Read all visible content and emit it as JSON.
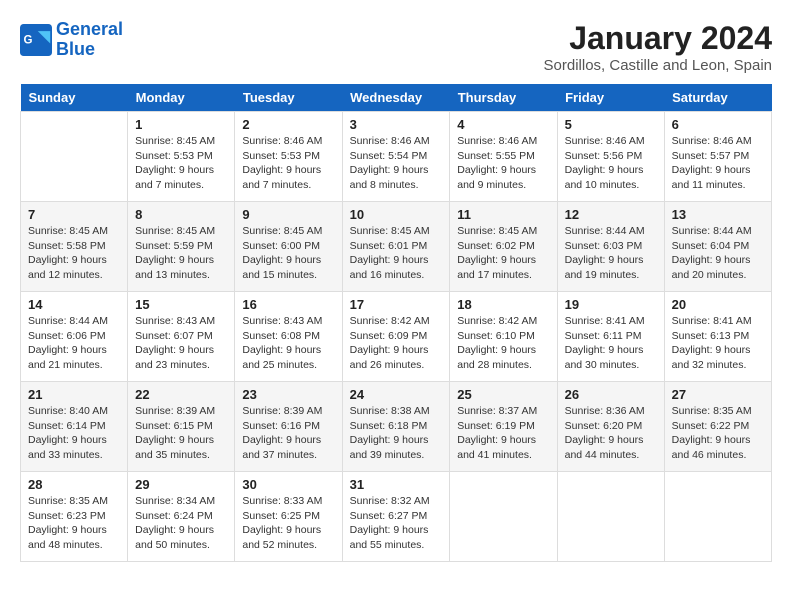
{
  "logo": {
    "line1": "General",
    "line2": "Blue"
  },
  "title": "January 2024",
  "location": "Sordillos, Castille and Leon, Spain",
  "headers": [
    "Sunday",
    "Monday",
    "Tuesday",
    "Wednesday",
    "Thursday",
    "Friday",
    "Saturday"
  ],
  "weeks": [
    [
      {
        "day": "",
        "sunrise": "",
        "sunset": "",
        "daylight": ""
      },
      {
        "day": "1",
        "sunrise": "Sunrise: 8:45 AM",
        "sunset": "Sunset: 5:53 PM",
        "daylight": "Daylight: 9 hours and 7 minutes."
      },
      {
        "day": "2",
        "sunrise": "Sunrise: 8:46 AM",
        "sunset": "Sunset: 5:53 PM",
        "daylight": "Daylight: 9 hours and 7 minutes."
      },
      {
        "day": "3",
        "sunrise": "Sunrise: 8:46 AM",
        "sunset": "Sunset: 5:54 PM",
        "daylight": "Daylight: 9 hours and 8 minutes."
      },
      {
        "day": "4",
        "sunrise": "Sunrise: 8:46 AM",
        "sunset": "Sunset: 5:55 PM",
        "daylight": "Daylight: 9 hours and 9 minutes."
      },
      {
        "day": "5",
        "sunrise": "Sunrise: 8:46 AM",
        "sunset": "Sunset: 5:56 PM",
        "daylight": "Daylight: 9 hours and 10 minutes."
      },
      {
        "day": "6",
        "sunrise": "Sunrise: 8:46 AM",
        "sunset": "Sunset: 5:57 PM",
        "daylight": "Daylight: 9 hours and 11 minutes."
      }
    ],
    [
      {
        "day": "7",
        "sunrise": "Sunrise: 8:45 AM",
        "sunset": "Sunset: 5:58 PM",
        "daylight": "Daylight: 9 hours and 12 minutes."
      },
      {
        "day": "8",
        "sunrise": "Sunrise: 8:45 AM",
        "sunset": "Sunset: 5:59 PM",
        "daylight": "Daylight: 9 hours and 13 minutes."
      },
      {
        "day": "9",
        "sunrise": "Sunrise: 8:45 AM",
        "sunset": "Sunset: 6:00 PM",
        "daylight": "Daylight: 9 hours and 15 minutes."
      },
      {
        "day": "10",
        "sunrise": "Sunrise: 8:45 AM",
        "sunset": "Sunset: 6:01 PM",
        "daylight": "Daylight: 9 hours and 16 minutes."
      },
      {
        "day": "11",
        "sunrise": "Sunrise: 8:45 AM",
        "sunset": "Sunset: 6:02 PM",
        "daylight": "Daylight: 9 hours and 17 minutes."
      },
      {
        "day": "12",
        "sunrise": "Sunrise: 8:44 AM",
        "sunset": "Sunset: 6:03 PM",
        "daylight": "Daylight: 9 hours and 19 minutes."
      },
      {
        "day": "13",
        "sunrise": "Sunrise: 8:44 AM",
        "sunset": "Sunset: 6:04 PM",
        "daylight": "Daylight: 9 hours and 20 minutes."
      }
    ],
    [
      {
        "day": "14",
        "sunrise": "Sunrise: 8:44 AM",
        "sunset": "Sunset: 6:06 PM",
        "daylight": "Daylight: 9 hours and 21 minutes."
      },
      {
        "day": "15",
        "sunrise": "Sunrise: 8:43 AM",
        "sunset": "Sunset: 6:07 PM",
        "daylight": "Daylight: 9 hours and 23 minutes."
      },
      {
        "day": "16",
        "sunrise": "Sunrise: 8:43 AM",
        "sunset": "Sunset: 6:08 PM",
        "daylight": "Daylight: 9 hours and 25 minutes."
      },
      {
        "day": "17",
        "sunrise": "Sunrise: 8:42 AM",
        "sunset": "Sunset: 6:09 PM",
        "daylight": "Daylight: 9 hours and 26 minutes."
      },
      {
        "day": "18",
        "sunrise": "Sunrise: 8:42 AM",
        "sunset": "Sunset: 6:10 PM",
        "daylight": "Daylight: 9 hours and 28 minutes."
      },
      {
        "day": "19",
        "sunrise": "Sunrise: 8:41 AM",
        "sunset": "Sunset: 6:11 PM",
        "daylight": "Daylight: 9 hours and 30 minutes."
      },
      {
        "day": "20",
        "sunrise": "Sunrise: 8:41 AM",
        "sunset": "Sunset: 6:13 PM",
        "daylight": "Daylight: 9 hours and 32 minutes."
      }
    ],
    [
      {
        "day": "21",
        "sunrise": "Sunrise: 8:40 AM",
        "sunset": "Sunset: 6:14 PM",
        "daylight": "Daylight: 9 hours and 33 minutes."
      },
      {
        "day": "22",
        "sunrise": "Sunrise: 8:39 AM",
        "sunset": "Sunset: 6:15 PM",
        "daylight": "Daylight: 9 hours and 35 minutes."
      },
      {
        "day": "23",
        "sunrise": "Sunrise: 8:39 AM",
        "sunset": "Sunset: 6:16 PM",
        "daylight": "Daylight: 9 hours and 37 minutes."
      },
      {
        "day": "24",
        "sunrise": "Sunrise: 8:38 AM",
        "sunset": "Sunset: 6:18 PM",
        "daylight": "Daylight: 9 hours and 39 minutes."
      },
      {
        "day": "25",
        "sunrise": "Sunrise: 8:37 AM",
        "sunset": "Sunset: 6:19 PM",
        "daylight": "Daylight: 9 hours and 41 minutes."
      },
      {
        "day": "26",
        "sunrise": "Sunrise: 8:36 AM",
        "sunset": "Sunset: 6:20 PM",
        "daylight": "Daylight: 9 hours and 44 minutes."
      },
      {
        "day": "27",
        "sunrise": "Sunrise: 8:35 AM",
        "sunset": "Sunset: 6:22 PM",
        "daylight": "Daylight: 9 hours and 46 minutes."
      }
    ],
    [
      {
        "day": "28",
        "sunrise": "Sunrise: 8:35 AM",
        "sunset": "Sunset: 6:23 PM",
        "daylight": "Daylight: 9 hours and 48 minutes."
      },
      {
        "day": "29",
        "sunrise": "Sunrise: 8:34 AM",
        "sunset": "Sunset: 6:24 PM",
        "daylight": "Daylight: 9 hours and 50 minutes."
      },
      {
        "day": "30",
        "sunrise": "Sunrise: 8:33 AM",
        "sunset": "Sunset: 6:25 PM",
        "daylight": "Daylight: 9 hours and 52 minutes."
      },
      {
        "day": "31",
        "sunrise": "Sunrise: 8:32 AM",
        "sunset": "Sunset: 6:27 PM",
        "daylight": "Daylight: 9 hours and 55 minutes."
      },
      {
        "day": "",
        "sunrise": "",
        "sunset": "",
        "daylight": ""
      },
      {
        "day": "",
        "sunrise": "",
        "sunset": "",
        "daylight": ""
      },
      {
        "day": "",
        "sunrise": "",
        "sunset": "",
        "daylight": ""
      }
    ]
  ]
}
